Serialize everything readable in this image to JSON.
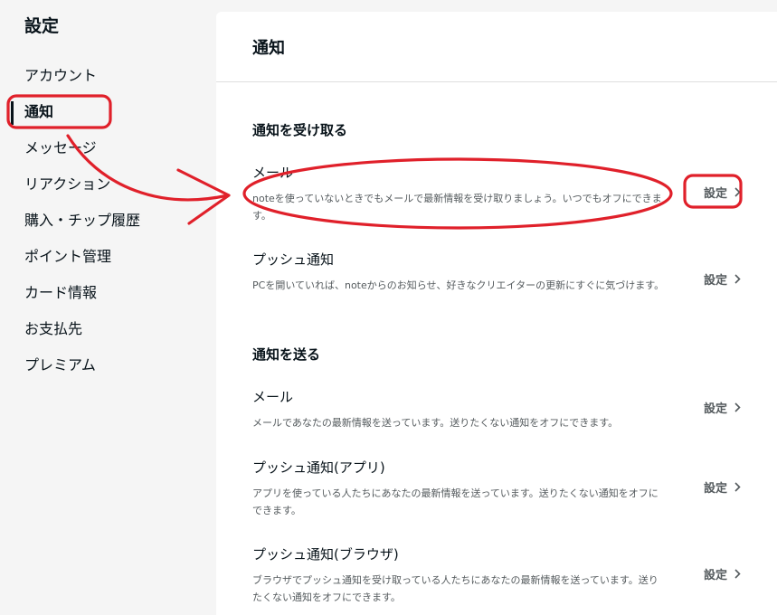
{
  "sidebar": {
    "title": "設定",
    "items": [
      {
        "label": "アカウント"
      },
      {
        "label": "通知"
      },
      {
        "label": "メッセージ"
      },
      {
        "label": "リアクション"
      },
      {
        "label": "購入・チップ履歴"
      },
      {
        "label": "ポイント管理"
      },
      {
        "label": "カード情報"
      },
      {
        "label": "お支払先"
      },
      {
        "label": "プレミアム"
      }
    ],
    "active_index": 1
  },
  "main": {
    "title": "通知",
    "receive": {
      "title": "通知を受け取る",
      "rows": [
        {
          "title": "メール",
          "desc": "noteを使っていないときでもメールで最新情報を受け取りましょう。いつでもオフにできます。",
          "button": "設定"
        },
        {
          "title": "プッシュ通知",
          "desc": "PCを開いていれば、noteからのお知らせ、好きなクリエイターの更新にすぐに気づけます。",
          "button": "設定"
        }
      ]
    },
    "send": {
      "title": "通知を送る",
      "rows": [
        {
          "title": "メール",
          "desc": "メールであなたの最新情報を送っています。送りたくない通知をオフにできます。",
          "button": "設定"
        },
        {
          "title": "プッシュ通知(アプリ)",
          "desc": "アプリを使っている人たちにあなたの最新情報を送っています。送りたくない通知をオフにできます。",
          "button": "設定"
        },
        {
          "title": "プッシュ通知(ブラウザ)",
          "desc": "ブラウザでプッシュ通知を受け取っている人たちにあなたの最新情報を送っています。送りたくない通知をオフにできます。",
          "button": "設定"
        }
      ]
    }
  },
  "icons": {
    "chevron": "chevron-right-icon"
  },
  "annotation": {
    "color": "#e0202a"
  }
}
